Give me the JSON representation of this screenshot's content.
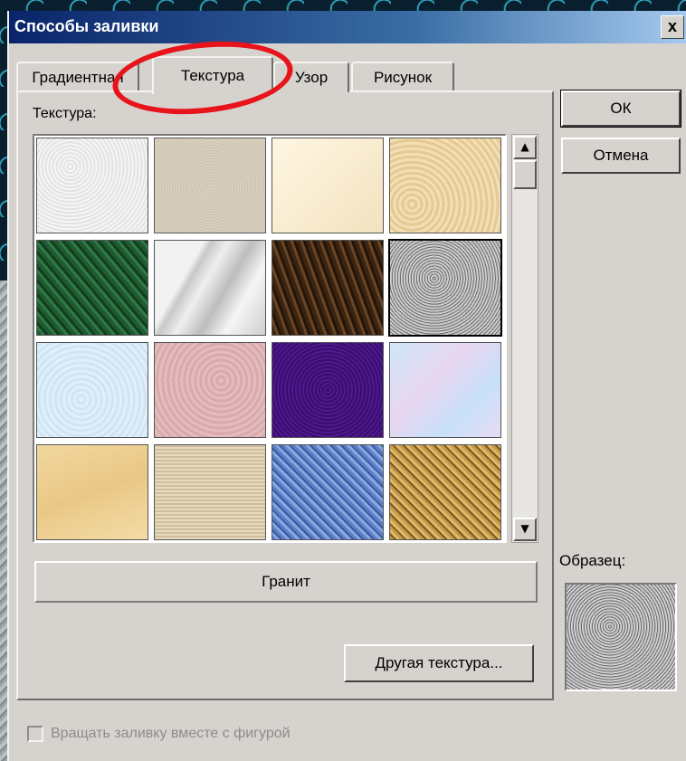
{
  "dialog": {
    "title": "Способы заливки",
    "close_label": "x"
  },
  "tabs": [
    {
      "label": "Градиентная"
    },
    {
      "label": "Текстура"
    },
    {
      "label": "Узор"
    },
    {
      "label": "Рисунок"
    }
  ],
  "texture_section": {
    "label": "Текстура:",
    "selected_name": "Гранит"
  },
  "buttons": {
    "ok": "ОК",
    "cancel": "Отмена",
    "other_texture": "Другая текстура..."
  },
  "sample": {
    "label": "Образец:"
  },
  "rotate_checkbox": {
    "label": "Вращать заливку вместе с фигурой",
    "checked": false,
    "enabled": false
  },
  "scrollbar": {
    "up_glyph": "▲",
    "down_glyph": "▼"
  }
}
